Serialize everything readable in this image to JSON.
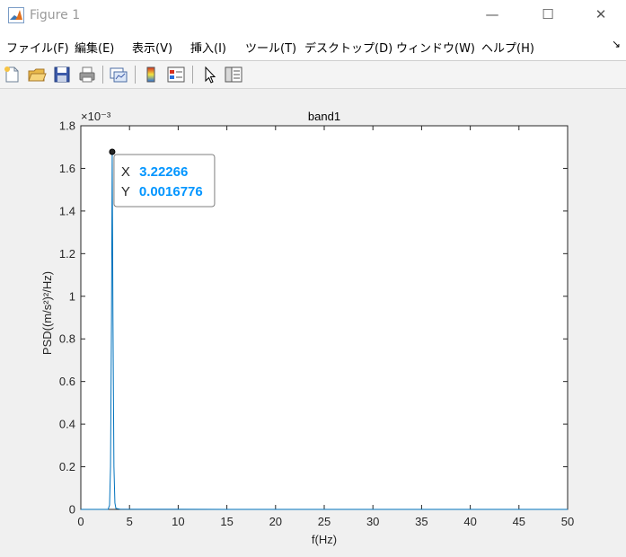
{
  "window": {
    "title": "Figure 1",
    "controls": {
      "minimize": "—",
      "maximize": "☐",
      "close": "✕"
    }
  },
  "menu": {
    "items": [
      "ファイル(F)",
      "編集(E)",
      "表示(V)",
      "挿入(I)",
      "ツール(T)",
      "デスクトップ(D)",
      "ウィンドウ(W)",
      "ヘルプ(H)"
    ],
    "dock_arrow": "↘"
  },
  "toolbar": {
    "icons": [
      "new-figure-icon",
      "open-file-icon",
      "save-icon",
      "print-icon",
      "link-plot-icon",
      "colorbar-icon",
      "legend-icon",
      "pointer-icon",
      "property-inspector-icon"
    ]
  },
  "chart_data": {
    "type": "line",
    "title": "band1",
    "xlabel": "f(Hz)",
    "ylabel": "PSD((m/s²)²/Hz)",
    "y_exponent": "×10⁻³",
    "xlim": [
      0,
      50
    ],
    "ylim": [
      0,
      1.8
    ],
    "xticks": [
      0,
      5,
      10,
      15,
      20,
      25,
      30,
      35,
      40,
      45,
      50
    ],
    "yticks": [
      0,
      0.2,
      0.4,
      0.6,
      0.8,
      1,
      1.2,
      1.4,
      1.6,
      1.8
    ],
    "ytick_labels": [
      "0",
      "0.2",
      "0.4",
      "0.6",
      "0.8",
      "1",
      "1.2",
      "1.4",
      "1.6",
      "1.8"
    ],
    "line_color": "#0072bd",
    "grid": false,
    "series": [
      {
        "x": [
          0,
          2.8,
          2.95,
          3.05,
          3.15,
          3.22266,
          3.3,
          3.4,
          3.5,
          3.6,
          4,
          6,
          8,
          10,
          15,
          20,
          25,
          30,
          35,
          40,
          45,
          50
        ],
        "y": [
          0,
          0,
          0.02,
          0.2,
          0.9,
          1.6776,
          0.9,
          0.2,
          0.03,
          0.005,
          0.001,
          0.0005,
          0.0004,
          0.0003,
          0.0002,
          0.0002,
          0.0001,
          0.0001,
          0.0001,
          0.0001,
          0.0001,
          0.0001
        ]
      }
    ],
    "datatip": {
      "x": 3.22266,
      "y": 1.6776,
      "x_label": "X",
      "y_label": "Y",
      "x_text": "3.22266",
      "y_text": "0.0016776",
      "value_color": "#0095ff"
    }
  }
}
